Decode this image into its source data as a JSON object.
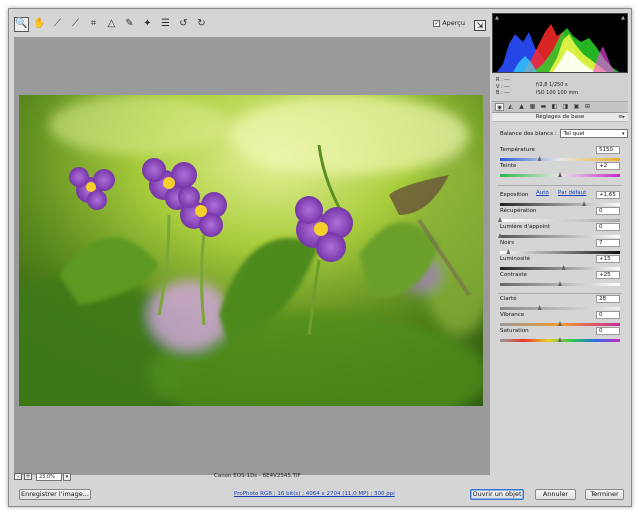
{
  "toolbar": {
    "tools": [
      {
        "name": "zoom-tool-icon",
        "glyph": "🔍"
      },
      {
        "name": "hand-tool-icon",
        "glyph": "✋"
      },
      {
        "name": "white-balance-tool-icon",
        "glyph": "⟋"
      },
      {
        "name": "color-sampler-tool-icon",
        "glyph": "⟋"
      },
      {
        "name": "crop-tool-icon",
        "glyph": "⌗"
      },
      {
        "name": "straighten-tool-icon",
        "glyph": "△"
      },
      {
        "name": "retouch-tool-icon",
        "glyph": "✎"
      },
      {
        "name": "red-eye-tool-icon",
        "glyph": "✦"
      },
      {
        "name": "preferences-icon",
        "glyph": "☰"
      },
      {
        "name": "rotate-left-icon",
        "glyph": "↺"
      },
      {
        "name": "rotate-right-icon",
        "glyph": "↻"
      }
    ],
    "preview_label": "Aperçu",
    "preview_checked": "✓",
    "fullscreen_glyph": "⇲"
  },
  "status": {
    "zoom_value": "23,0%",
    "minus": "-",
    "plus": "+",
    "dropdown": "▾",
    "filename": "Canon EOS-1Ds  -  6E4V2545.TIF"
  },
  "bottom": {
    "save_label": "Enregistrer l'image...",
    "workflow_info": "ProPhoto RGB ; 16 bit(s) ; 4064 x 2704 (11,0 MP) ; 300 ppi",
    "open_label": "Ouvrir un objet",
    "cancel_label": "Annuler",
    "done_label": "Terminer"
  },
  "histogram": {
    "r": "R :  ---",
    "g": "V :  ---",
    "b": "B :  ---",
    "aperture_shutter": "f/2,8   1/250 s",
    "iso_focal": "ISO 100   100 mm",
    "clip_shadow": "▲",
    "clip_highlight": "▲"
  },
  "panel": {
    "title": "Réglages de base",
    "menu": "≡▸",
    "tabs": [
      "◉",
      "◭",
      "▲",
      "▦",
      "▬",
      "◧",
      "◨",
      "▣",
      "⊞"
    ],
    "wb_label": "Balance des blancs :",
    "wb_value": "Tel quel",
    "wb_arrow": "▾",
    "auto_label": "Auto",
    "default_label": "Par défaut",
    "sliders": [
      {
        "label": "Température",
        "value": "5150",
        "level": 0.33
      },
      {
        "label": "Teinte",
        "value": "+2",
        "level": 0.5
      },
      {
        "label": "Exposition",
        "value": "+1,65",
        "level": 0.7
      },
      {
        "label": "Récupération",
        "value": "0",
        "level": 0.0
      },
      {
        "label": "Lumière d'appoint",
        "value": "0",
        "level": 0.0
      },
      {
        "label": "Noirs",
        "value": "7",
        "level": 0.07
      },
      {
        "label": "Luminosité",
        "value": "+15",
        "level": 0.53
      },
      {
        "label": "Contraste",
        "value": "+25",
        "level": 0.5
      },
      {
        "label": "Clarté",
        "value": "28",
        "level": 0.33
      },
      {
        "label": "Vibrance",
        "value": "0",
        "level": 0.5
      },
      {
        "label": "Saturation",
        "value": "0",
        "level": 0.5
      }
    ]
  },
  "colors": {
    "accent": "#3a74c8",
    "link": "#1a3fb8",
    "canvas": "#9a9a9a"
  }
}
